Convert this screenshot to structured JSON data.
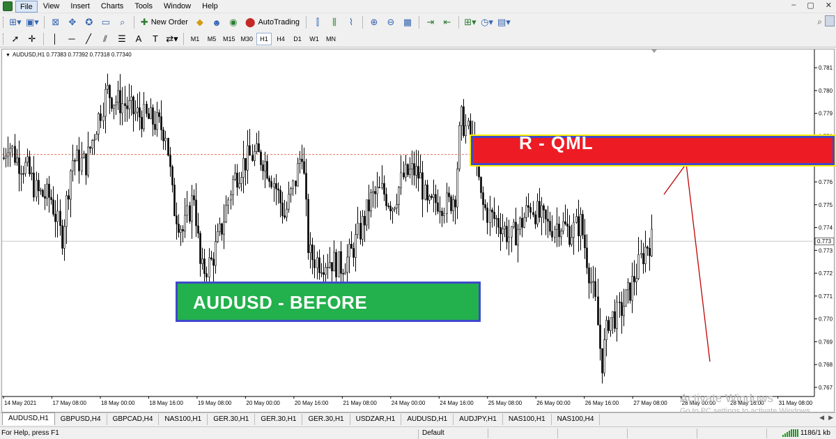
{
  "window": {
    "menus": [
      "File",
      "View",
      "Insert",
      "Charts",
      "Tools",
      "Window",
      "Help"
    ],
    "controls": [
      "–",
      "▢",
      "✕"
    ]
  },
  "toolbar": {
    "new_order": "New Order",
    "auto_trading": "AutoTrading",
    "timeframes": [
      "M1",
      "M5",
      "M15",
      "M30",
      "H1",
      "H4",
      "D1",
      "W1",
      "MN"
    ],
    "active_timeframe": "H1"
  },
  "chart": {
    "info": "AUDUSD,H1  0.77383 0.77392 0.77318 0.77340",
    "current_price_label": "0.773",
    "resistance_level_label": "0.777",
    "overlay_before": "AUDUSD -  BEFORE",
    "overlay_qml": "R - QML",
    "colors": {
      "before_fill": "#22b14c",
      "qml_fill": "#ed1c24",
      "overlay_border": "#3f48cc",
      "arrow": "#c00000"
    }
  },
  "chart_data": {
    "type": "candlestick",
    "symbol": "AUDUSD",
    "timeframe": "H1",
    "y_ticks": [
      0.781,
      0.78,
      0.779,
      0.778,
      0.777,
      0.776,
      0.775,
      0.774,
      0.773,
      0.772,
      0.771,
      0.77,
      0.769,
      0.768,
      0.767
    ],
    "y_tick_labels": [
      "0.781",
      "0.780",
      "0.779",
      "0.778",
      "0.777",
      "0.776",
      "0.775",
      "0.774",
      "0.773",
      "0.772",
      "0.771",
      "0.770",
      "0.769",
      "0.768",
      "0.767"
    ],
    "ylim": [
      0.7666,
      0.7818
    ],
    "x_labels": [
      "14 May 2021",
      "17 May 08:00",
      "18 May 00:00",
      "18 May 16:00",
      "19 May 08:00",
      "20 May 00:00",
      "20 May 16:00",
      "21 May 08:00",
      "24 May 00:00",
      "24 May 16:00",
      "25 May 08:00",
      "26 May 00:00",
      "26 May 16:00",
      "27 May 08:00",
      "28 May 00:00",
      "28 May 16:00",
      "31 May 08:00"
    ],
    "current_price": 0.7734,
    "dashed_level": 0.7772,
    "path": [
      [
        0,
        0.7768
      ],
      [
        8,
        0.7778
      ],
      [
        20,
        0.777
      ],
      [
        35,
        0.7766
      ],
      [
        50,
        0.7755
      ],
      [
        70,
        0.7753
      ],
      [
        85,
        0.7735
      ],
      [
        100,
        0.777
      ],
      [
        120,
        0.7768
      ],
      [
        135,
        0.7785
      ],
      [
        150,
        0.78
      ],
      [
        160,
        0.7796
      ],
      [
        175,
        0.7794
      ],
      [
        190,
        0.779
      ],
      [
        205,
        0.7788
      ],
      [
        220,
        0.7786
      ],
      [
        235,
        0.7782
      ],
      [
        245,
        0.775
      ],
      [
        260,
        0.7738
      ],
      [
        275,
        0.7755
      ],
      [
        285,
        0.772
      ],
      [
        300,
        0.7725
      ],
      [
        315,
        0.774
      ],
      [
        330,
        0.776
      ],
      [
        345,
        0.7768
      ],
      [
        360,
        0.7772
      ],
      [
        375,
        0.777
      ],
      [
        390,
        0.776
      ],
      [
        405,
        0.7745
      ],
      [
        420,
        0.776
      ],
      [
        430,
        0.7775
      ],
      [
        440,
        0.7728
      ],
      [
        455,
        0.7725
      ],
      [
        470,
        0.7726
      ],
      [
        485,
        0.7723
      ],
      [
        500,
        0.7728
      ],
      [
        515,
        0.774
      ],
      [
        530,
        0.7753
      ],
      [
        545,
        0.7756
      ],
      [
        560,
        0.775
      ],
      [
        575,
        0.7762
      ],
      [
        590,
        0.7765
      ],
      [
        600,
        0.7762
      ],
      [
        610,
        0.7748
      ],
      [
        625,
        0.7752
      ],
      [
        640,
        0.775
      ],
      [
        650,
        0.7755
      ],
      [
        658,
        0.7788
      ],
      [
        668,
        0.7782
      ],
      [
        678,
        0.7775
      ],
      [
        688,
        0.775
      ],
      [
        700,
        0.7745
      ],
      [
        715,
        0.7742
      ],
      [
        730,
        0.7735
      ],
      [
        745,
        0.7742
      ],
      [
        758,
        0.775
      ],
      [
        770,
        0.7745
      ],
      [
        785,
        0.774
      ],
      [
        800,
        0.7742
      ],
      [
        815,
        0.7738
      ],
      [
        830,
        0.7742
      ],
      [
        840,
        0.7725
      ],
      [
        852,
        0.7705
      ],
      [
        860,
        0.768
      ],
      [
        870,
        0.77
      ],
      [
        885,
        0.7702
      ],
      [
        900,
        0.7712
      ],
      [
        912,
        0.7722
      ],
      [
        924,
        0.7732
      ],
      [
        934,
        0.7735
      ]
    ]
  },
  "tabs": [
    "AUDUSD,H1",
    "GBPUSD,H4",
    "GBPCAD,H4",
    "NAS100,H1",
    "GER.30,H1",
    "GER.30,H1",
    "GER.30,H1",
    "USDZAR,H1",
    "AUDUSD,H1",
    "AUDJPY,H1",
    "NAS100,H1",
    "NAS100,H4"
  ],
  "status": {
    "help": "For Help, press F1",
    "profile": "Default",
    "traffic": "1186/1 kb"
  },
  "watermark": {
    "line1": "Activate Windows",
    "line2": "Go to PC settings to activate Windows."
  }
}
